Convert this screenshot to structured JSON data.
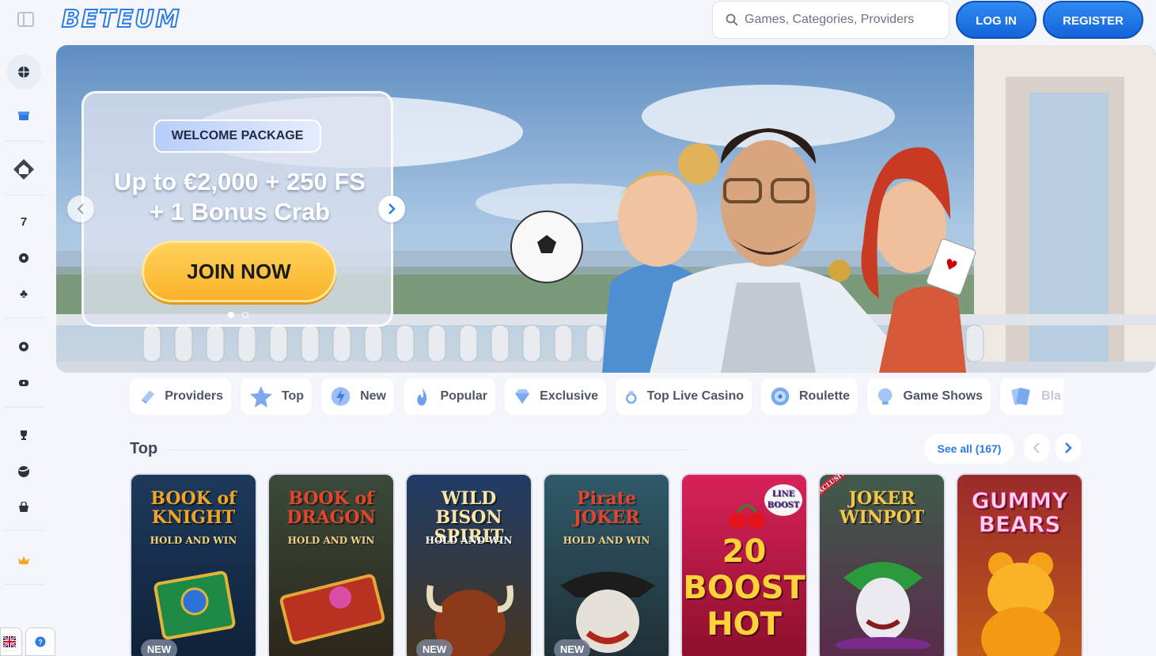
{
  "header": {
    "logo_text": "BETEUM",
    "search_placeholder": "Games, Categories, Providers",
    "login_label": "LOG IN",
    "register_label": "REGISTER"
  },
  "sidebar": {
    "items": [
      {
        "icon": "sports-ball-icon"
      },
      {
        "icon": "gift-icon"
      },
      {
        "icon": "home-icon"
      },
      {
        "icon": "slots-seven-icon"
      },
      {
        "icon": "roulette-icon"
      },
      {
        "icon": "clubs-icon"
      },
      {
        "icon": "football-icon"
      },
      {
        "icon": "ticket-icon"
      },
      {
        "icon": "trophy-icon"
      },
      {
        "icon": "tennis-ball-icon"
      },
      {
        "icon": "shop-bag-icon"
      },
      {
        "icon": "vip-crown-icon"
      }
    ],
    "language_flag": "gb-flag-icon",
    "help_icon": "help-icon"
  },
  "hero": {
    "badge": "WELCOME PACKAGE",
    "title_line1": "Up to €2,000 + 250 FS",
    "title_line2": "+ 1 Bonus Crab",
    "cta": "JOIN NOW",
    "slides_total": 2,
    "slide_active": 1
  },
  "categories": [
    {
      "label": "Providers",
      "icon": "providers-icon"
    },
    {
      "label": "Top",
      "icon": "star-icon"
    },
    {
      "label": "New",
      "icon": "lightning-icon"
    },
    {
      "label": "Popular",
      "icon": "flame-icon"
    },
    {
      "label": "Exclusive",
      "icon": "diamond-icon"
    },
    {
      "label": "Top Live Casino",
      "icon": "ring-icon"
    },
    {
      "label": "Roulette",
      "icon": "roulette-icon"
    },
    {
      "label": "Game Shows",
      "icon": "game-shows-icon"
    },
    {
      "label": "Bla",
      "icon": "blackjack-icon"
    }
  ],
  "section": {
    "title": "Top",
    "see_all": "See all (167)"
  },
  "games": [
    {
      "title": "BOOK of KNIGHT",
      "subtitle": "HOLD AND WIN",
      "badge": "NEW"
    },
    {
      "title": "BOOK of DRAGON",
      "subtitle": "HOLD AND WIN",
      "badge": ""
    },
    {
      "title": "WILD BISON SPIRIT",
      "subtitle": "HOLD AND WIN",
      "badge": "NEW"
    },
    {
      "title": "Pirate JOKER",
      "subtitle": "HOLD AND WIN",
      "badge": "NEW"
    },
    {
      "title": "20 BOOST HOT",
      "subtitle": "LINE BOOST",
      "badge": ""
    },
    {
      "title": "JOKER WINPOT",
      "subtitle": "EXCLUSIVE",
      "badge": ""
    },
    {
      "title": "GUMMY BEARS",
      "subtitle": "",
      "badge": ""
    }
  ],
  "colors": {
    "primary": "#1f74e6",
    "cta": "#fbb22a",
    "background": "#f4f6fb"
  }
}
